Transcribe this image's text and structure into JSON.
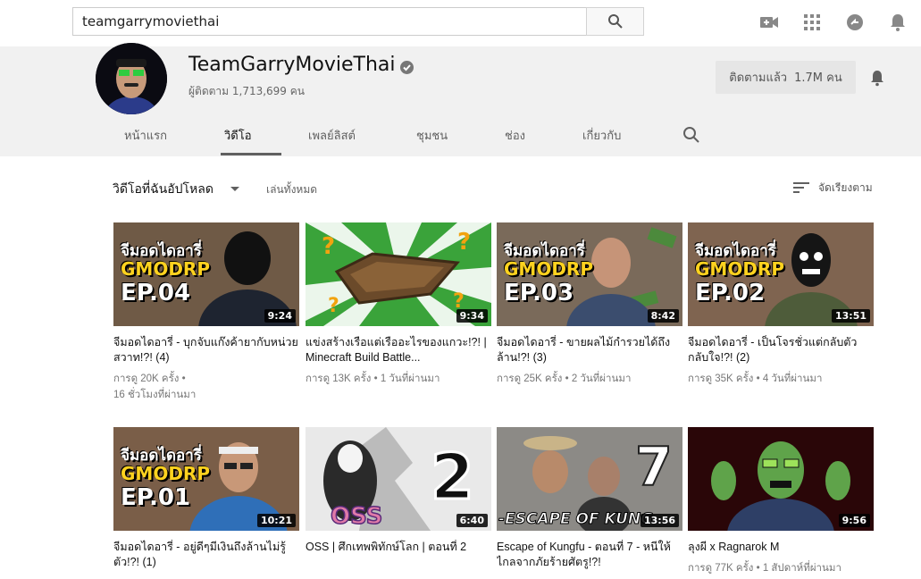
{
  "search": {
    "value": "teamgarrymoviethai"
  },
  "channel": {
    "name": "TeamGarryMovieThai",
    "subscribers": "ผู้ติดตาม 1,713,699 คน",
    "subscribe_label": "ติดตามแล้ว",
    "subscribe_count": "1.7M คน"
  },
  "tabs": [
    {
      "label": "หน้าแรก"
    },
    {
      "label": "วิดีโอ"
    },
    {
      "label": "เพลย์ลิสต์"
    },
    {
      "label": "ชุมชน"
    },
    {
      "label": "ช่อง"
    },
    {
      "label": "เกี่ยวกับ"
    }
  ],
  "shelf": {
    "title": "วิดีโอที่ฉันอัปโหลด",
    "play_all": "เล่นทั้งหมด",
    "sort": "จัดเรียงตาม"
  },
  "thumb_text": {
    "series": "จีมอดไดอารี่",
    "gmodrp": "GMODRP",
    "ep4": "EP.04",
    "ep3": "EP.03",
    "ep2": "EP.02",
    "ep1": "EP.01",
    "kungfu": "-ESCAPE OF KUNG",
    "oss": "OSS",
    "oss_num": "2",
    "kungfu_num": "7"
  },
  "videos": [
    {
      "title": "จีมอดไดอารี่ - บุกจับแก๊งค้ายากับหน่วยสวาท!?! (4)",
      "meta1": "การดู 20K ครั้ง •",
      "meta2": "16 ชั่วโมงที่ผ่านมา",
      "duration": "9:24"
    },
    {
      "title": "แข่งสร้างเรือแต่เรืออะไรของแกวะ!?! | Minecraft Build Battle...",
      "meta1": "การดู 13K ครั้ง • 1 วันที่ผ่านมา",
      "meta2": "",
      "duration": "9:34"
    },
    {
      "title": "จีมอดไดอารี่ - ขายผลไม้กำรวยได้ถึงล้าน!?! (3)",
      "meta1": "การดู 25K ครั้ง • 2 วันที่ผ่านมา",
      "meta2": "",
      "duration": "8:42"
    },
    {
      "title": "จีมอดไดอารี่ - เป็นโจรชั่วแต่กลับตัวกลับใจ!?! (2)",
      "meta1": "การดู 35K ครั้ง • 4 วันที่ผ่านมา",
      "meta2": "",
      "duration": "13:51"
    },
    {
      "title": "จีมอดไดอารี่ - อยู่ดีๆมีเงินถึงล้านไม่รู้ตัว!?! (1)",
      "meta1": "",
      "meta2": "",
      "duration": "10:21"
    },
    {
      "title": "OSS | ศึกเทพพิทักษ์โลก | ตอนที่ 2",
      "meta1": "",
      "meta2": "",
      "duration": "6:40"
    },
    {
      "title": "Escape of Kungfu - ตอนที่ 7 - หนีให้ไกลจากภัยร้ายศัตรู!?!",
      "meta1": "",
      "meta2": "",
      "duration": "13:56"
    },
    {
      "title": "ลุงผี x Ragnarok M",
      "meta1": "การดู 77K ครั้ง • 1 สัปดาห์ที่ผ่านมา",
      "meta2": "",
      "duration": "9:56"
    }
  ],
  "colors": {
    "header_bg": "#f1f1f1",
    "accent_yellow": "#ffd21f",
    "thumb_green": "#3aa33a"
  }
}
